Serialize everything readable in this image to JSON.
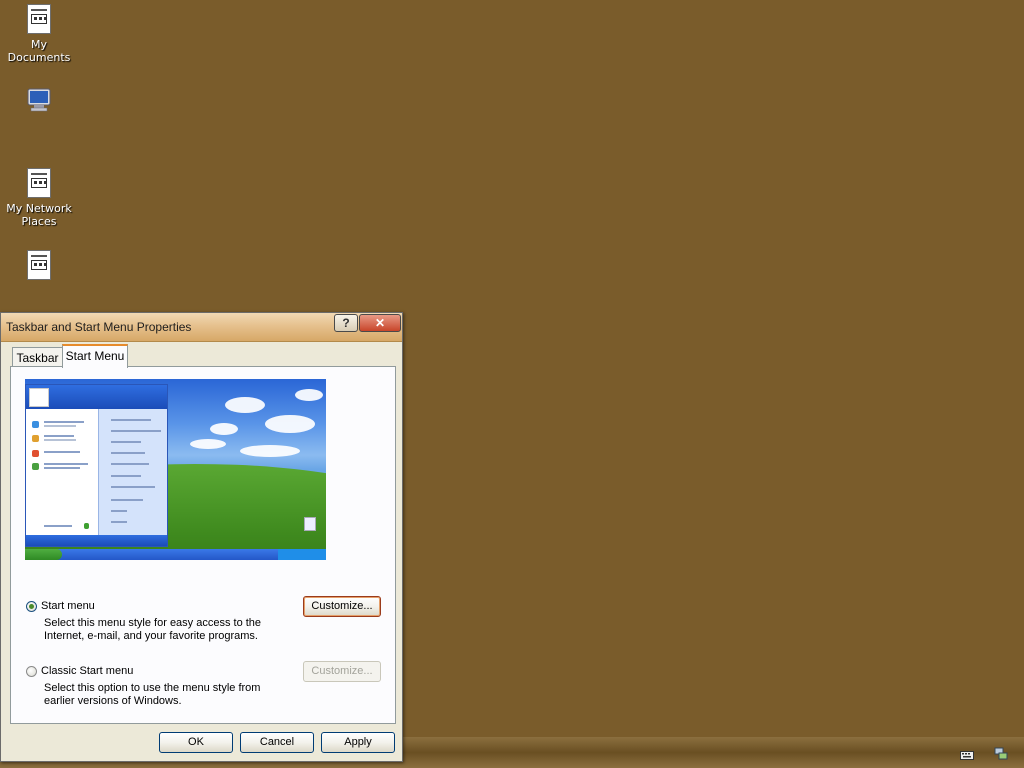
{
  "desktop": {
    "icons": [
      {
        "label": "My\nDocuments",
        "type": "document"
      },
      {
        "label": "",
        "type": "computer"
      },
      {
        "label": "My Network\nPlaces",
        "type": "document"
      },
      {
        "label": "",
        "type": "document"
      }
    ]
  },
  "dialog": {
    "title": "Taskbar and Start Menu Properties",
    "help_label": "?",
    "close_label": "✕",
    "tabs": [
      {
        "label": "Taskbar",
        "selected": false
      },
      {
        "label": "Start Menu",
        "selected": true
      }
    ],
    "options": [
      {
        "label": "Start menu",
        "description": "Select this menu style for easy access to the Internet, e-mail, and your favorite programs.",
        "checked": true,
        "customize_label": "Customize...",
        "customize_enabled": true
      },
      {
        "label": "Classic Start menu",
        "description": "Select this option to use the menu style from earlier versions of Windows.",
        "checked": false,
        "customize_label": "Customize...",
        "customize_enabled": false
      }
    ],
    "buttons": {
      "ok": "OK",
      "cancel": "Cancel",
      "apply": "Apply"
    }
  },
  "tray": {
    "icons": [
      "keyboard-icon",
      "network-icon"
    ]
  }
}
